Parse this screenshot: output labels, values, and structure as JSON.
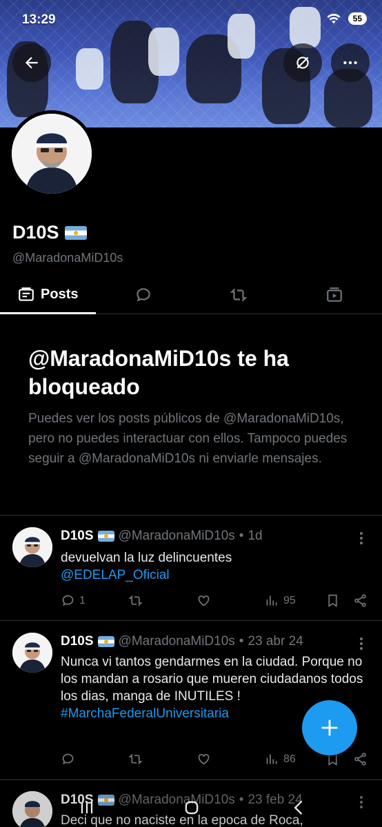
{
  "status_bar": {
    "time": "13:29",
    "battery": "55"
  },
  "profile": {
    "display_name": "D10S",
    "handle": "@MaradonaMiD10s"
  },
  "tabs": [
    {
      "label": "Posts",
      "icon": "posts-icon",
      "active": true
    },
    {
      "label": "",
      "icon": "reply-bubble-icon",
      "active": false
    },
    {
      "label": "",
      "icon": "retweet-icon",
      "active": false
    },
    {
      "label": "",
      "icon": "media-icon",
      "active": false
    }
  ],
  "blocked": {
    "title": "@MaradonaMiD10s te ha bloqueado",
    "body": "Puedes ver los posts públicos de @MaradonaMiD10s, pero no puedes interactuar con ellos. Tampoco puedes seguir a @MaradonaMiD10s ni enviarle mensajes."
  },
  "posts": [
    {
      "author": "D10S",
      "handle": "@MaradonaMiD10s",
      "time": "1d",
      "text": "devuelvan la luz delincuentes",
      "link": "@EDELAP_Oficial",
      "replies": "1",
      "retweets": "",
      "likes": "",
      "views": "95"
    },
    {
      "author": "D10S",
      "handle": "@MaradonaMiD10s",
      "time": "23 abr 24",
      "text": "Nunca vi tantos gendarmes en la ciudad. Porque no los mandan a rosario que mueren ciudadanos todos los dias, manga de INUTILES !",
      "link": " #MarchaFederalUniversitaria",
      "replies": "",
      "retweets": "",
      "likes": "",
      "views": "86"
    },
    {
      "author": "D10S",
      "handle": "@MaradonaMiD10s",
      "time": "23 feb 24",
      "text": "Deci que no naciste en la epoca de Roca,"
    }
  ],
  "colors": {
    "accent": "#1d9bf0",
    "muted": "#71767b",
    "background": "#000000"
  }
}
